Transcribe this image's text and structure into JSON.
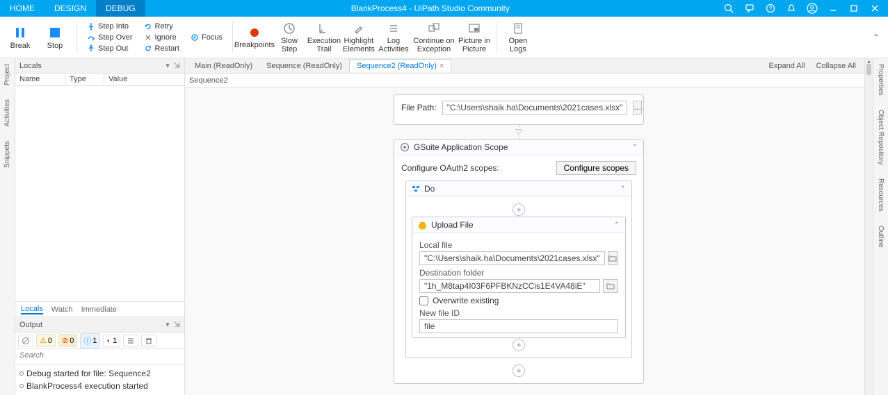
{
  "titlebar": {
    "tabs": [
      "HOME",
      "DESIGN",
      "DEBUG"
    ],
    "active_tab": 2,
    "title": "BlankProcess4 - UiPath Studio Community"
  },
  "ribbon": {
    "break": "Break",
    "stop": "Stop",
    "step_into": "Step Into",
    "step_over": "Step Over",
    "step_out": "Step Out",
    "retry": "Retry",
    "ignore": "Ignore",
    "restart": "Restart",
    "focus": "Focus",
    "breakpoints": "Breakpoints",
    "slow_step": "Slow\nStep",
    "exec_trail": "Execution\nTrail",
    "highlight": "Highlight\nElements",
    "log_act": "Log\nActivities",
    "cont_exc": "Continue on\nException",
    "pip": "Picture in\nPicture",
    "open_logs": "Open\nLogs"
  },
  "leftrail": [
    "Project",
    "Activities",
    "Snippets"
  ],
  "rightrail": [
    "Properties",
    "Object Repository",
    "Resources",
    "Outline"
  ],
  "locals": {
    "header": "Locals",
    "cols": {
      "name": "Name",
      "type": "Type",
      "value": "Value"
    }
  },
  "bottom_tabs": {
    "locals": "Locals",
    "watch": "Watch",
    "immediate": "Immediate"
  },
  "output": {
    "header": "Output",
    "counts": {
      "warn": "0",
      "err": "0",
      "info": "1",
      "trace": "1"
    },
    "search_placeholder": "Search",
    "lines": [
      "Debug started for file: Sequence2",
      "BlankProcess4 execution started"
    ]
  },
  "doc_tabs": {
    "items": [
      "Main (ReadOnly)",
      "Sequence (ReadOnly)",
      "Sequence2 (ReadOnly)"
    ],
    "active": 2,
    "expand_all": "Expand All",
    "collapse_all": "Collapse All"
  },
  "breadcrumb": "Sequence2",
  "designer": {
    "file_path_label": "File Path:",
    "file_path_value": "\"C:\\Users\\shaik.ha\\Documents\\2021cases.xlsx\"",
    "gsuite": {
      "title": "GSuite Application Scope",
      "conf_label": "Configure OAuth2 scopes:",
      "conf_button": "Configure scopes",
      "do_title": "Do",
      "upload": {
        "title": "Upload File",
        "local_file_label": "Local file",
        "local_file_value": "\"C:\\Users\\shaik.ha\\Documents\\2021cases.xlsx\"",
        "dest_label": "Destination folder",
        "dest_value": "\"1h_M8tap4I03F6PFBKNzCCis1E4VA48iE\"",
        "overwrite_label": "Overwrite existing",
        "newid_label": "New file ID",
        "newid_value": "file"
      }
    }
  }
}
